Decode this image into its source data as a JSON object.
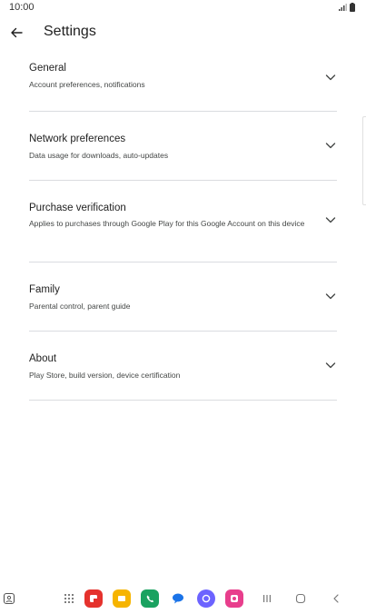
{
  "status_bar": {
    "time": "10:00"
  },
  "header": {
    "title": "Settings"
  },
  "settings": [
    {
      "title": "General",
      "subtitle": "Account preferences, notifications"
    },
    {
      "title": "Network preferences",
      "subtitle": "Data usage for downloads, auto-updates"
    },
    {
      "title": "Purchase verification",
      "subtitle": "Applies to purchases through Google Play for this Google Account on this device"
    },
    {
      "title": "Family",
      "subtitle": "Parental control, parent guide"
    },
    {
      "title": "About",
      "subtitle": "Play Store, build version, device certification"
    }
  ],
  "taskbar": {
    "apps": [
      {
        "name": "app-drawer-icon",
        "color": "#555555"
      },
      {
        "name": "flipboard-icon",
        "color": "#e5322d"
      },
      {
        "name": "my-files-icon",
        "color": "#f6b400"
      },
      {
        "name": "phone-icon",
        "color": "#1aa260"
      },
      {
        "name": "messages-icon",
        "color": "#1a73e8"
      },
      {
        "name": "internet-icon",
        "color": "#6c63ff"
      },
      {
        "name": "screen-recorder-icon",
        "color": "#e83e8c"
      }
    ]
  }
}
